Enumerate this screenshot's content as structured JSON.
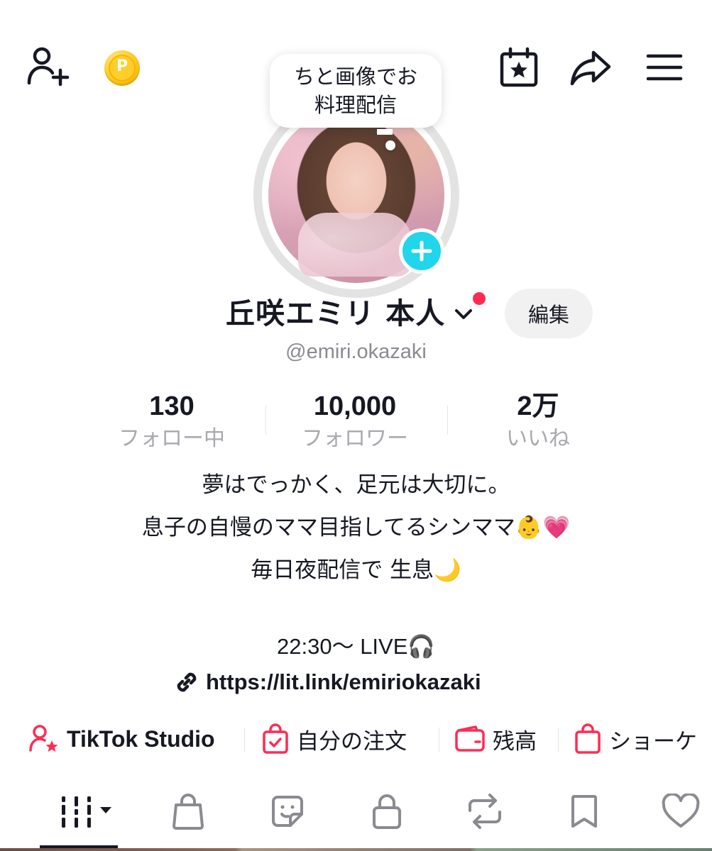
{
  "header": {
    "add_friend_icon": "person-plus-icon",
    "coin_icon": "p-coin-icon",
    "coin_letter": "P",
    "calendar_icon": "calendar-star-icon",
    "share_icon": "share-arrow-icon",
    "menu_icon": "hamburger-menu-icon"
  },
  "note_bubble": {
    "text": "ちと画像でお\n料理配信"
  },
  "profile": {
    "display_name": "丘咲エミリ 本人",
    "edit_label": "編集",
    "username": "@emiri.okazaki"
  },
  "stats": [
    {
      "value": "130",
      "label": "フォロー中"
    },
    {
      "value": "10,000",
      "label": "フォロワー"
    },
    {
      "value": "2万",
      "label": "いいね"
    }
  ],
  "bio": {
    "line1": "夢はでっかく、足元は大切に。",
    "line2": "息子の自慢のママ目指してるシンママ👶💗",
    "line3": "毎日夜配信で 生息🌙",
    "live_line": "22:30〜 LIVE🎧",
    "link": "https://lit.link/emiriokazaki"
  },
  "tools": [
    {
      "label": "TikTok Studio",
      "icon": "person-star-icon"
    },
    {
      "label": "自分の注文",
      "icon": "bag-check-icon"
    },
    {
      "label": "残高",
      "icon": "wallet-icon"
    },
    {
      "label": "ショーケ",
      "icon": "shopping-bag-icon"
    }
  ],
  "tabs": [
    {
      "name": "videos",
      "icon": "grid-bars-icon",
      "active": true
    },
    {
      "name": "shop",
      "icon": "shopping-bag-icon"
    },
    {
      "name": "stickers",
      "icon": "sticker-icon"
    },
    {
      "name": "private",
      "icon": "lock-icon"
    },
    {
      "name": "reposts",
      "icon": "repost-icon"
    },
    {
      "name": "saved",
      "icon": "bookmark-icon"
    },
    {
      "name": "liked",
      "icon": "heart-icon"
    }
  ],
  "colors": {
    "accent_red": "#fe2c55",
    "accent_cyan": "#20d5ec",
    "text_primary": "#161823",
    "text_secondary": "#8a8b91"
  }
}
